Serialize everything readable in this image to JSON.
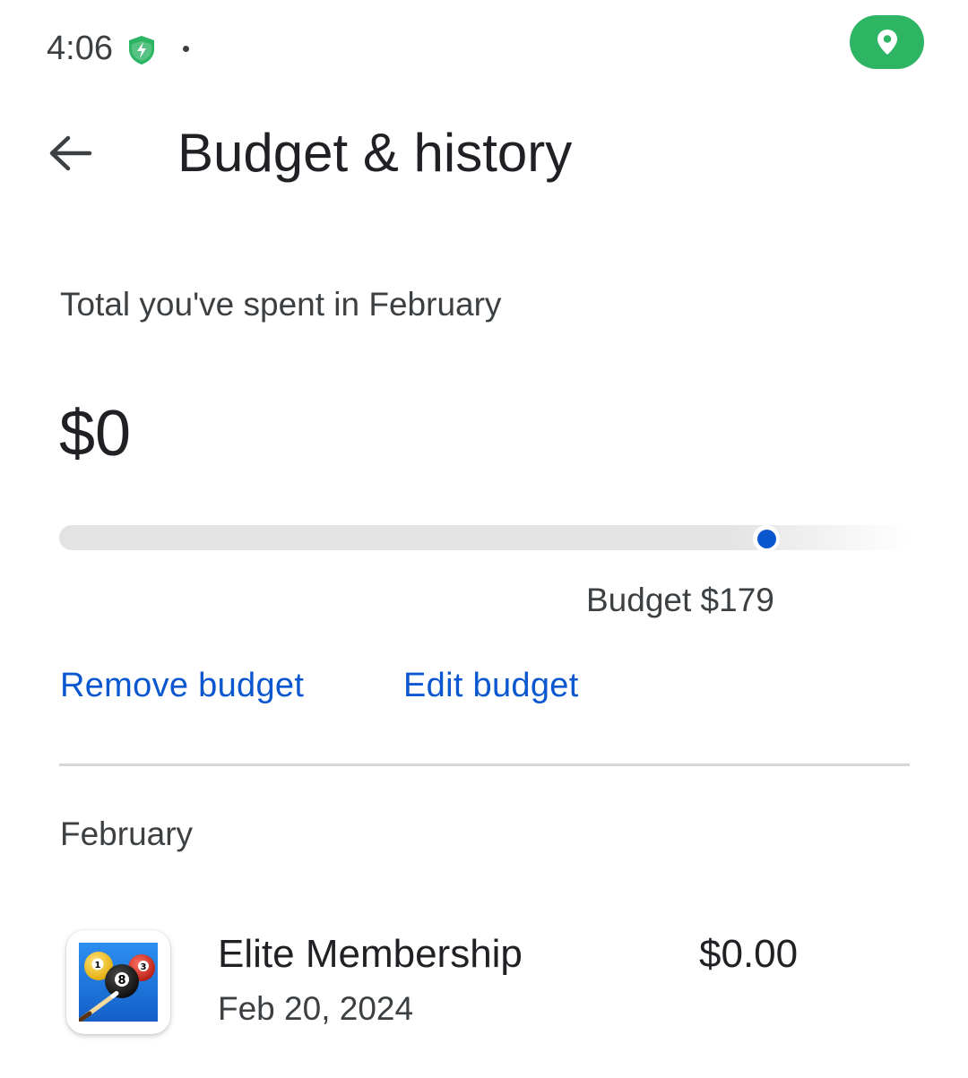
{
  "status_bar": {
    "time": "4:06",
    "icons": [
      "shield-bolt-icon",
      "notification-dot-icon",
      "location-pin-icon"
    ],
    "location_pill_color": "#2db563"
  },
  "header": {
    "back_icon": "arrow-back-icon",
    "title": "Budget & history"
  },
  "summary": {
    "label": "Total you've spent in February",
    "amount": "$0",
    "budget_label": "Budget $179",
    "spent_fraction_of_budget": 0
  },
  "actions": {
    "remove_label": "Remove budget",
    "edit_label": "Edit budget"
  },
  "history": {
    "month": "February",
    "transactions": [
      {
        "icon": "8-ball-pool-app-icon",
        "name": "Elite Membership",
        "date": "Feb 20, 2024",
        "price": "$0.00"
      }
    ]
  },
  "colors": {
    "accent": "#0b57d0",
    "text_primary": "#202124",
    "text_secondary": "#3c4043",
    "track": "#e3e3e3",
    "divider": "#d6d6d6"
  }
}
